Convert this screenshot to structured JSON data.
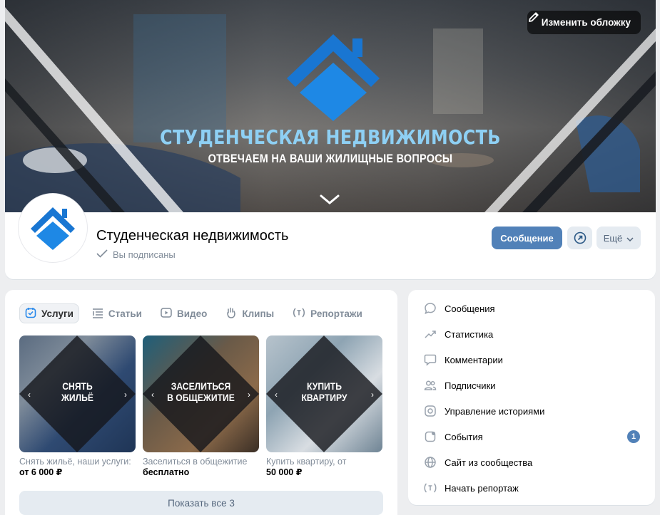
{
  "colors": {
    "accent": "#5181b8",
    "logo_blue": "#1e88e5",
    "muted": "#818c99"
  },
  "cover": {
    "change_cover_label": "Изменить обложку",
    "title": "СТУДЕНЧЕСКАЯ НЕДВИЖИМОСТЬ",
    "subtitle": "ОТВЕЧАЕМ НА ВАШИ ЖИЛИЩНЫЕ ВОПРОСЫ"
  },
  "group": {
    "name": "Студенческая недвижимость",
    "subscription_status": "Вы подписаны"
  },
  "actions": {
    "message_label": "Сообщение",
    "more_label": "Ещё"
  },
  "services": {
    "tabs": [
      {
        "label": "Услуги",
        "icon": "checklist-icon"
      },
      {
        "label": "Статьи",
        "icon": "article-icon"
      },
      {
        "label": "Видео",
        "icon": "video-icon"
      },
      {
        "label": "Клипы",
        "icon": "clips-icon"
      },
      {
        "label": "Репортажи",
        "icon": "live-icon"
      }
    ],
    "items": [
      {
        "tile_label": "СНЯТЬ\nЖИЛЬЁ",
        "caption": "Снять жильё, наши услуги:",
        "price": "от 6 000 ₽"
      },
      {
        "tile_label": "ЗАСЕЛИТЬСЯ\nВ ОБЩЕЖИТИЕ",
        "caption": "Заселиться в общежитие",
        "price": "бесплатно"
      },
      {
        "tile_label": "КУПИТЬ\nКВАРТИРУ",
        "caption": "Купить квартиру, от",
        "price": "50 000 ₽"
      }
    ],
    "show_all_label": "Показать все 3"
  },
  "menu": {
    "items": [
      {
        "label": "Сообщения",
        "icon": "message-icon"
      },
      {
        "label": "Статистика",
        "icon": "stats-icon"
      },
      {
        "label": "Комментарии",
        "icon": "comment-icon"
      },
      {
        "label": "Подписчики",
        "icon": "users-icon"
      },
      {
        "label": "Управление историями",
        "icon": "stories-icon"
      },
      {
        "label": "События",
        "icon": "events-icon",
        "badge": "1"
      },
      {
        "label": "Сайт из сообщества",
        "icon": "globe-icon"
      },
      {
        "label": "Начать репортаж",
        "icon": "live-icon"
      }
    ]
  }
}
